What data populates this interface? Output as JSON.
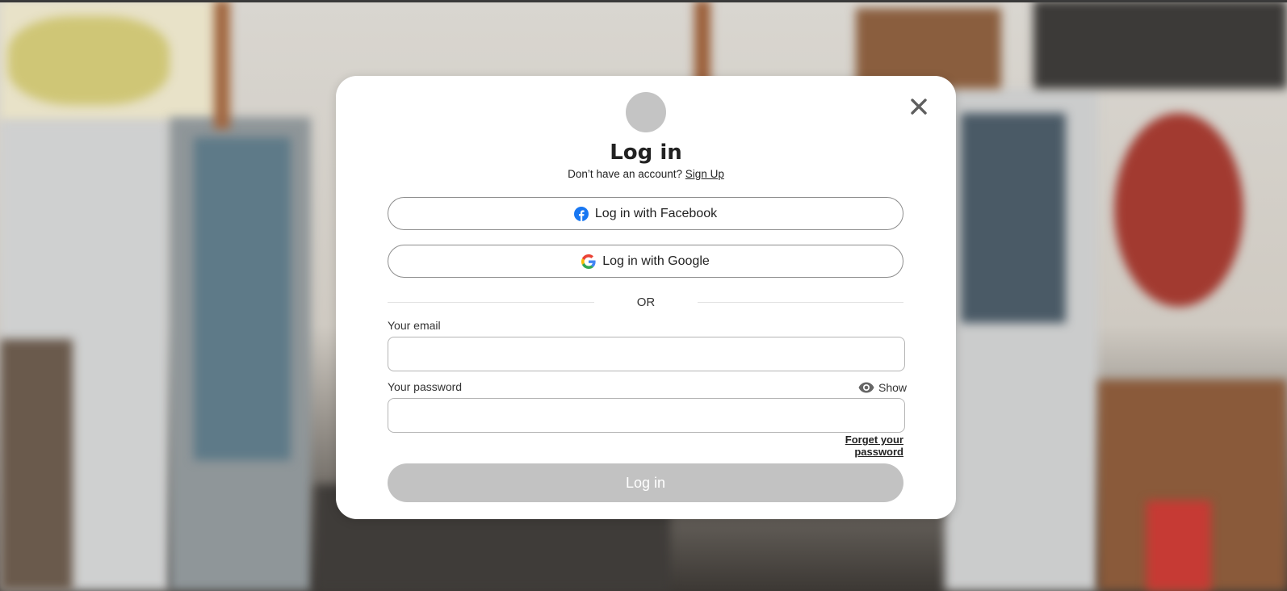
{
  "modal": {
    "title": "Log in",
    "subtitle_text": "Don’t have an account?",
    "signup_link": "Sign Up",
    "facebook_button": "Log in with Facebook",
    "google_button": "Log in with Google",
    "divider_text": "OR",
    "email_label": "Your email",
    "email_value": "",
    "password_label": "Your password",
    "password_value": "",
    "show_toggle": "Show",
    "forgot_link": "Forget your password",
    "submit_button": "Log in"
  },
  "icons": {
    "close": "close-icon",
    "facebook": "facebook-icon",
    "google": "google-icon",
    "eye": "eye-icon"
  },
  "colors": {
    "facebook_blue": "#1877f2",
    "submit_disabled": "#c2c2c2",
    "logo_placeholder": "#c4c4c4"
  }
}
